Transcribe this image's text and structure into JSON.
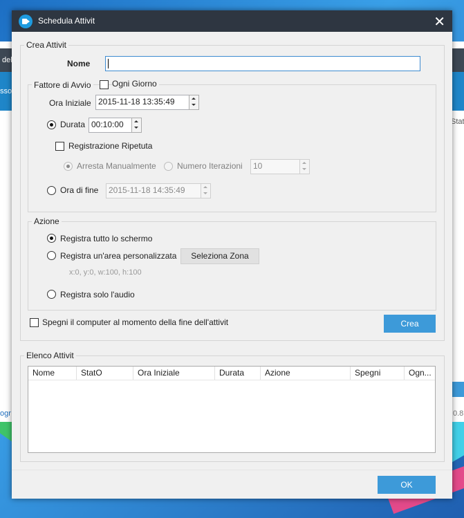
{
  "background": {
    "app_fragments": [
      "del",
      "sso",
      "Stat",
      "ogr",
      "0.8"
    ]
  },
  "dialog": {
    "title": "Schedula Attivit",
    "close_glyph": "✕"
  },
  "crea": {
    "legend": "Crea Attivit",
    "nome_label": "Nome",
    "nome_value": "",
    "fattore": {
      "legend": "Fattore di Avvio",
      "ogni_giorno_label": "Ogni Giorno",
      "ora_iniziale_label": "Ora Iniziale",
      "ora_iniziale_value": "2015-11-18 13:35:49",
      "durata_label": "Durata",
      "durata_value": "00:10:00",
      "registrazione_ripetuta_label": "Registrazione Ripetuta",
      "arresta_label": "Arresta Manualmente",
      "numero_label": "Numero Iterazioni",
      "numero_value": "10",
      "ora_fine_label": "Ora di fine",
      "ora_fine_value": "2015-11-18 14:35:49"
    },
    "azione": {
      "legend": "Azione",
      "tutto_label": "Registra tutto lo schermo",
      "area_label": "Registra un'area personalizzata",
      "seleziona_label": "Seleziona Zona",
      "coords": "x:0, y:0, w:100, h:100",
      "audio_label": "Registra solo l'audio"
    },
    "spegni_label": "Spegni il computer al momento della fine dell'attivit",
    "crea_button": "Crea"
  },
  "elenco": {
    "legend": "Elenco Attivit",
    "columns": [
      "Nome",
      "StatO",
      "Ora Iniziale",
      "Durata",
      "Azione",
      "Spegni",
      "Ogn..."
    ]
  },
  "ok_button": "OK",
  "colors": {
    "titlebar": "#2e3641",
    "accent": "#3d9ad9",
    "dialog_bg": "#f0f0f0"
  }
}
